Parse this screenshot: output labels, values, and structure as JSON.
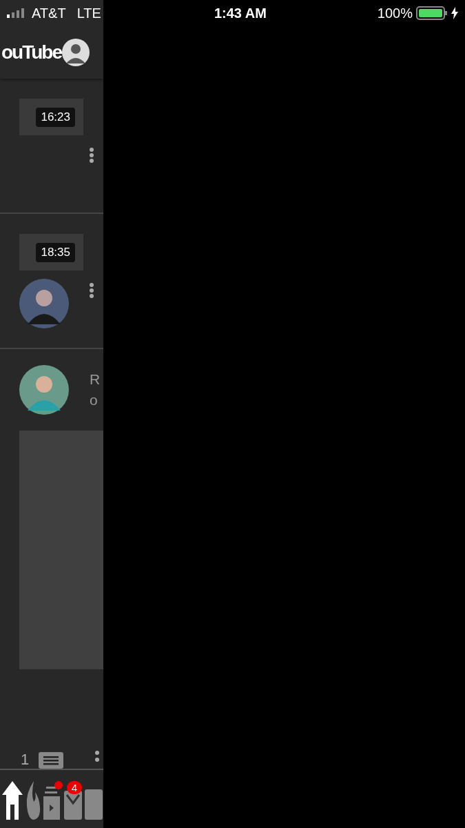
{
  "status_bar": {
    "carrier": "AT&T",
    "network": "LTE",
    "time": "1:43 AM",
    "battery": "100%"
  },
  "header": {
    "logo": "ouTube"
  },
  "feed": [
    {
      "kind": "video",
      "duration": "16:23"
    },
    {
      "kind": "video",
      "duration": "18:35"
    },
    {
      "kind": "post",
      "lines": [
        "R",
        "o"
      ]
    }
  ],
  "footer_row": {
    "count": "1"
  },
  "bottom_nav": [
    {
      "kind": "home",
      "selected": true
    },
    {
      "kind": "trending",
      "selected": false
    },
    {
      "kind": "subscriptions",
      "selected": false,
      "dot": true
    },
    {
      "kind": "inbox",
      "selected": false,
      "badge": "4"
    },
    {
      "kind": "library",
      "selected": false
    }
  ]
}
